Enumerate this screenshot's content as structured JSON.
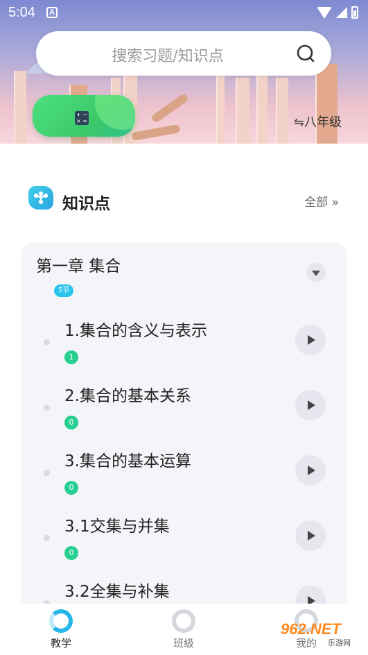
{
  "status_bar": {
    "time": "5:04",
    "notification_icon": "A"
  },
  "search": {
    "placeholder": "搜索习题/知识点"
  },
  "grade_selector": {
    "label": "⇋八年级"
  },
  "section": {
    "title": "知识点",
    "all_label": "全部 »"
  },
  "chapter": {
    "title": "第一章 集合",
    "badge": "5节",
    "lessons": [
      {
        "name": "1.集合的含义与表示",
        "count": "1"
      },
      {
        "name": "2.集合的基本关系",
        "count": "0"
      },
      {
        "name": "3.集合的基本运算",
        "count": "0"
      },
      {
        "name": "3.1交集与并集",
        "count": "0"
      },
      {
        "name": "3.2全集与补集",
        "count": ""
      }
    ]
  },
  "bottom_nav": {
    "items": [
      {
        "label": "教学",
        "active": true
      },
      {
        "label": "班级",
        "active": false
      },
      {
        "label": "我的",
        "active": false
      }
    ]
  },
  "watermark": {
    "brand": "962.NET",
    "sub": "乐游网"
  },
  "colors": {
    "accent": "#27b6ea",
    "count_badge": "#27cf91",
    "calc_green": "#3cc96a"
  }
}
